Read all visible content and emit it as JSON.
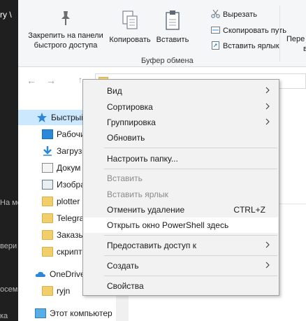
{
  "background_window": {
    "title_fragment": "ry \\",
    "fragments": [
      "Ha мо",
      "вери",
      "осем",
      "ка"
    ]
  },
  "ribbon": {
    "pin_label_1": "Закрепить на панели",
    "pin_label_2": "быстрого доступа",
    "copy_label": "Копировать",
    "paste_label": "Вставить",
    "cut_label": "Вырезать",
    "copy_path_label": "Скопировать путь",
    "paste_shortcut_label": "Вставить ярлык",
    "group_label": "Буфер обмена",
    "right_fragment_1": "Пере",
    "right_fragment_2": "в"
  },
  "nav_pane": {
    "items": [
      {
        "label": "Быстрый",
        "icon": "star-icon",
        "selected": true
      },
      {
        "label": "Рабочи",
        "icon": "desktop-icon"
      },
      {
        "label": "Загруз",
        "icon": "download-icon"
      },
      {
        "label": "Докум",
        "icon": "document-icon"
      },
      {
        "label": "Изобра",
        "icon": "pictures-icon"
      },
      {
        "label": "plotter",
        "icon": "folder-icon"
      },
      {
        "label": "Telegra",
        "icon": "folder-icon"
      },
      {
        "label": "Заказы",
        "icon": "folder-icon"
      },
      {
        "label": "скрипт",
        "icon": "folder-icon"
      },
      {
        "label": "OneDrive",
        "icon": "cloud-icon"
      },
      {
        "label": "ryjn",
        "icon": "folder-icon"
      },
      {
        "label": "Этот компьютер",
        "icon": "computer-icon"
      }
    ]
  },
  "context_menu": {
    "items": [
      {
        "label": "Вид",
        "submenu": true
      },
      {
        "label": "Сортировка",
        "submenu": true
      },
      {
        "label": "Группировка",
        "submenu": true
      },
      {
        "label": "Обновить"
      },
      {
        "label": "Настроить папку..."
      },
      {
        "label": "Вставить",
        "disabled": true
      },
      {
        "label": "Вставить ярлык",
        "disabled": true
      },
      {
        "label": "Отменить удаление",
        "shortcut": "CTRL+Z"
      },
      {
        "label": "Открыть окно PowerShell здесь",
        "highlighted": true
      },
      {
        "label": "Предоставить доступ к",
        "submenu": true
      },
      {
        "label": "Создать",
        "submenu": true
      },
      {
        "label": "Свойства"
      }
    ]
  },
  "colors": {
    "selection": "#cce8ff",
    "menu_bg": "#f2f2f2",
    "folder": "#f3cf6a",
    "accent": "#2b88d8"
  }
}
